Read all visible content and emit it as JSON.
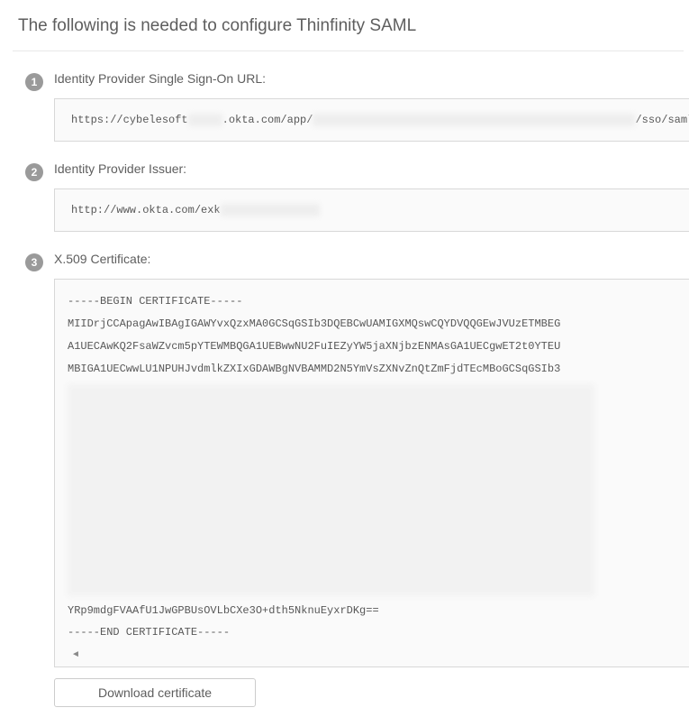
{
  "header": {
    "title": "The following is needed to configure Thinfinity SAML"
  },
  "steps": {
    "one": {
      "num": "1",
      "label": "Identity Provider Single Sign-On URL:"
    },
    "two": {
      "num": "2",
      "label": "Identity Provider Issuer:"
    },
    "three": {
      "num": "3",
      "label": "X.509 Certificate:"
    }
  },
  "sso_url": {
    "prefix": "https://cybelesoft",
    "mid": ".okta.com/app/",
    "suffix": "/sso/saml"
  },
  "issuer_url": {
    "prefix": "http://www.okta.com/exk"
  },
  "certificate": {
    "begin": "-----BEGIN CERTIFICATE-----",
    "line1": "MIIDrjCCApagAwIBAgIGAWYvxQzxMA0GCSqGSIb3DQEBCwUAMIGXMQswCQYDVQQGEwJVUzETMBEG",
    "line2": "A1UECAwKQ2FsaWZvcm5pYTEWMBQGA1UEBwwNU2FuIEZyYW5jaXNjbzENMAsGA1UECgwET2t0YTEU",
    "line3": "MBIGA1UECwwLU1NPUHJvdmlkZXIxGDAWBgNVBAMMD2N5YmVsZXNvZnQtZmFjdTEcMBoGCSqGSIb3",
    "line_last": "YRp9mdgFVAAfU1JwGPBUsOVLbCXe3O+dth5NknuEyxrDKg==",
    "end": "-----END CERTIFICATE-----"
  },
  "download_button": {
    "label": "Download certificate"
  }
}
